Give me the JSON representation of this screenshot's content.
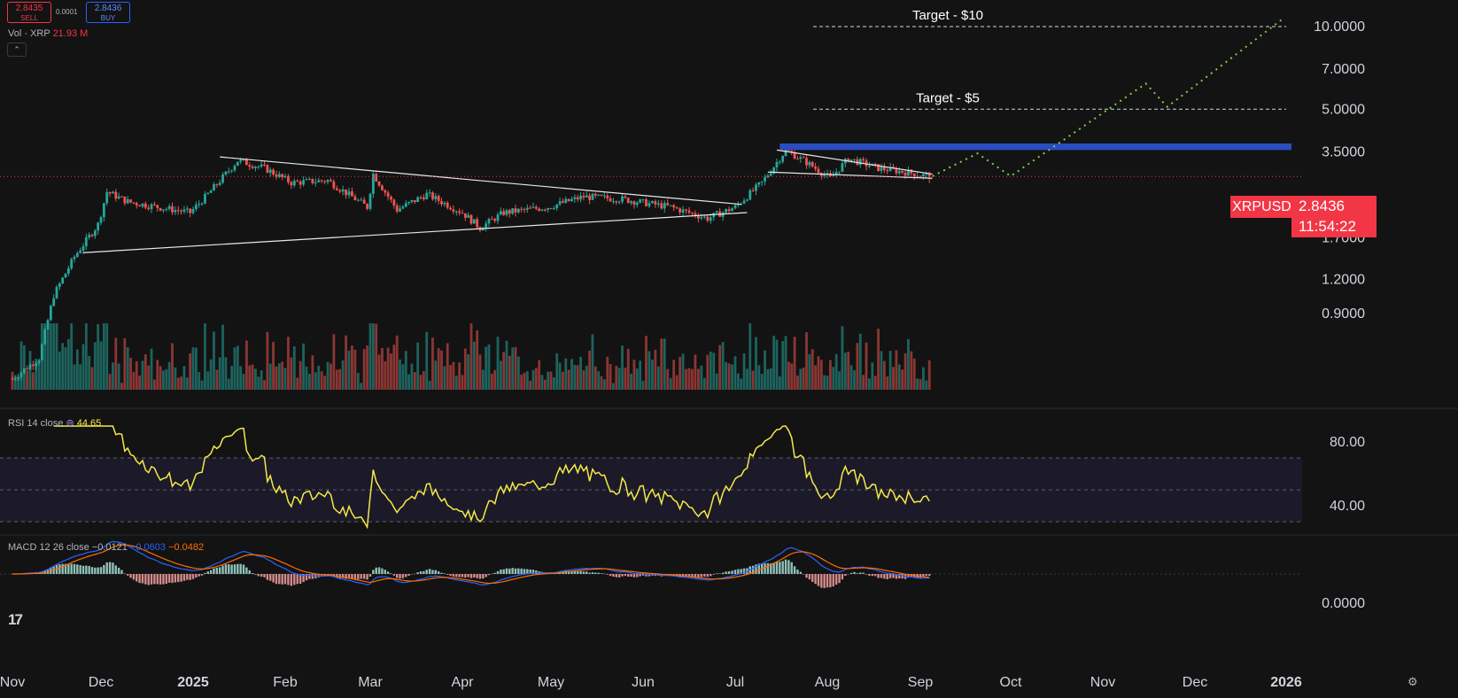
{
  "header": {
    "sell_price": "2.8435",
    "sell_label": "SELL",
    "spread": "0.0001",
    "buy_price": "2.8436",
    "buy_label": "BUY",
    "vol_label": "Vol · XRP",
    "vol_value": "21.93 M",
    "rsi_label": "RSI 14 close",
    "rsi_value": "44.65",
    "macd_label": "MACD 12 26 close",
    "macd_macd": "−0.0121",
    "macd_signal": "−0.0603",
    "macd_hist": "−0.0482"
  },
  "price_tag": {
    "symbol": "XRPUSD",
    "price": "2.8436",
    "countdown": "11:54:22"
  },
  "colors": {
    "background": "#131313",
    "up": "#26a69a",
    "down": "#ef5350",
    "rsi": "#f5e94a",
    "macd_line": "#2962ff",
    "signal_line": "#ff6d00",
    "zone": "#2a4dbf",
    "projection": "#7cd04b",
    "tag": "#f23645"
  },
  "icons": {
    "collapse": "chevron-up-icon",
    "logo": "tradingview-logo-icon",
    "settings": "settings-gear-icon"
  },
  "chart_data": [
    {
      "type": "candlestick",
      "title": "XRPUSD",
      "scale": "log",
      "x_ticks": [
        "Nov",
        "Dec",
        "2025",
        "Feb",
        "Mar",
        "Apr",
        "May",
        "Jun",
        "Jul",
        "Aug",
        "Sep",
        "Oct",
        "Nov",
        "Dec",
        "2026"
      ],
      "y_ticks": [
        "10.0000",
        "7.0000",
        "5.0000",
        "3.5000",
        "1.7000",
        "1.2000",
        "0.9000"
      ],
      "last_price": 2.8436,
      "close_path": [
        {
          "date": "2024-11-01",
          "close": 0.52
        },
        {
          "date": "2024-11-10",
          "close": 0.62
        },
        {
          "date": "2024-11-15",
          "close": 1.05
        },
        {
          "date": "2024-11-22",
          "close": 1.45
        },
        {
          "date": "2024-11-30",
          "close": 1.9
        },
        {
          "date": "2024-12-03",
          "close": 2.5
        },
        {
          "date": "2024-12-10",
          "close": 2.3
        },
        {
          "date": "2024-12-20",
          "close": 2.2
        },
        {
          "date": "2024-12-31",
          "close": 2.1
        },
        {
          "date": "2025-01-06",
          "close": 2.45
        },
        {
          "date": "2025-01-16",
          "close": 3.25
        },
        {
          "date": "2025-01-25",
          "close": 3.05
        },
        {
          "date": "2025-02-03",
          "close": 2.7
        },
        {
          "date": "2025-02-15",
          "close": 2.75
        },
        {
          "date": "2025-02-28",
          "close": 2.2
        },
        {
          "date": "2025-03-02",
          "close": 2.9
        },
        {
          "date": "2025-03-10",
          "close": 2.15
        },
        {
          "date": "2025-03-20",
          "close": 2.45
        },
        {
          "date": "2025-04-01",
          "close": 2.1
        },
        {
          "date": "2025-04-07",
          "close": 1.85
        },
        {
          "date": "2025-04-15",
          "close": 2.1
        },
        {
          "date": "2025-04-30",
          "close": 2.2
        },
        {
          "date": "2025-05-12",
          "close": 2.4
        },
        {
          "date": "2025-05-25",
          "close": 2.35
        },
        {
          "date": "2025-06-10",
          "close": 2.2
        },
        {
          "date": "2025-06-22",
          "close": 2.0
        },
        {
          "date": "2025-07-01",
          "close": 2.2
        },
        {
          "date": "2025-07-10",
          "close": 2.7
        },
        {
          "date": "2025-07-18",
          "close": 3.55
        },
        {
          "date": "2025-07-25",
          "close": 3.2
        },
        {
          "date": "2025-08-02",
          "close": 2.8
        },
        {
          "date": "2025-08-08",
          "close": 3.3
        },
        {
          "date": "2025-08-18",
          "close": 3.05
        },
        {
          "date": "2025-08-27",
          "close": 2.95
        },
        {
          "date": "2025-09-04",
          "close": 2.8436
        }
      ],
      "annotations": [
        {
          "text": "Target - $10",
          "price": 10.0
        },
        {
          "text": "Target - $5",
          "price": 5.0
        },
        {
          "text": "resistance zone",
          "price_low": 3.55,
          "price_high": 3.75
        },
        {
          "text": "projection",
          "points": [
            {
              "date": "2025-09-05",
              "price": 2.85
            },
            {
              "date": "2025-09-20",
              "price": 3.45
            },
            {
              "date": "2025-10-01",
              "price": 2.85
            },
            {
              "date": "2025-11-15",
              "price": 6.2
            },
            {
              "date": "2025-11-22",
              "price": 5.1
            },
            {
              "date": "2025-12-31",
              "price": 10.7
            }
          ]
        }
      ]
    },
    {
      "type": "line",
      "title": "RSI 14 close",
      "y_ticks": [
        "80.00",
        "40.00"
      ],
      "bands": [
        70,
        50,
        30
      ],
      "last_value": 44.65
    },
    {
      "type": "line",
      "title": "MACD 12 26 close",
      "y_ticks": [
        "0.0000"
      ],
      "series": [
        {
          "name": "MACD",
          "last": -0.0121
        },
        {
          "name": "Signal",
          "last": -0.0603
        },
        {
          "name": "Histogram",
          "last": -0.0482
        }
      ]
    }
  ]
}
